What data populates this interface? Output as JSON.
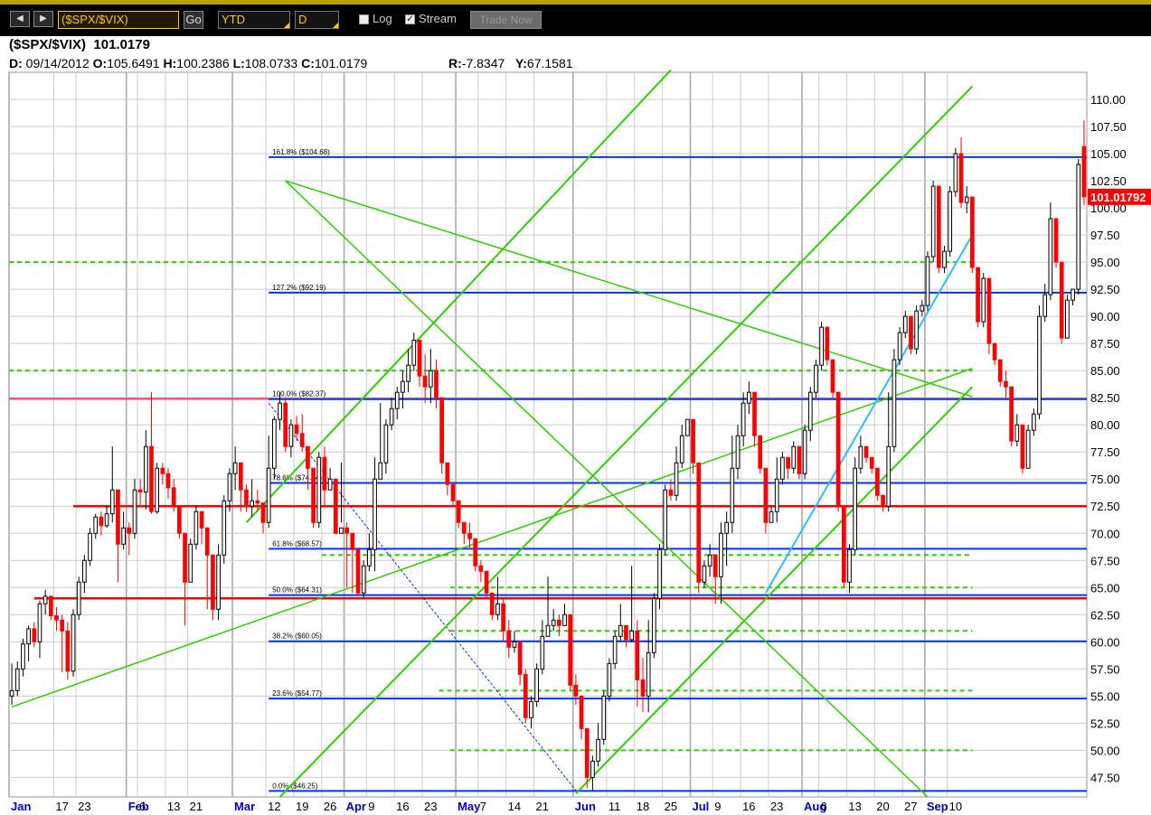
{
  "toolbar": {
    "symbol": "($SPX/$VIX)",
    "go_label": "Go",
    "range": "YTD",
    "period": "D",
    "log_label": "Log",
    "log_checked": false,
    "stream_label": "Stream",
    "stream_checked": true,
    "trade_label": "Trade Now",
    "prev_glyph": "◀",
    "next_glyph": "▶",
    "check_glyph": "✓"
  },
  "header": {
    "symbol": "($SPX/$VIX)",
    "last": "101.0179",
    "d_label": "D:",
    "date": "09/14/2012",
    "o_label": "O:",
    "open": "105.6491",
    "h_label": "H:",
    "high": "100.2386",
    "l_label": "L:",
    "low": "108.0733",
    "c_label": "C:",
    "close": "101.0179",
    "r_label": "R:",
    "r": "-7.8347",
    "y_label": "Y:",
    "y": "67.1581"
  },
  "colors": {
    "up": "#000000",
    "down": "#ff0000",
    "fib": "#0033ff",
    "support": "#ff0000",
    "pink": "#ff3366",
    "trend": "#33cc00",
    "dotted": "#33cc00",
    "cyan": "#33bbff",
    "price_label_bg": "#ff0000",
    "grid": "#cccccc",
    "month_label": "#0000cc"
  },
  "chart_data": {
    "type": "candlestick",
    "title": "($SPX/$VIX) 101.0179",
    "ylim": [
      45.7,
      112.5
    ],
    "y_ticks": [
      "110.00",
      "107.50",
      "105.00",
      "102.50",
      "100.00",
      "97.50",
      "95.00",
      "92.50",
      "90.00",
      "87.50",
      "85.00",
      "82.50",
      "80.00",
      "77.50",
      "75.00",
      "72.50",
      "70.00",
      "67.50",
      "65.00",
      "62.50",
      "60.00",
      "57.50",
      "55.00",
      "52.50",
      "50.00",
      "47.50"
    ],
    "x_labels": [
      {
        "label": "Jan",
        "month": true,
        "i": 0
      },
      {
        "label": "17",
        "i": 8
      },
      {
        "label": "23",
        "i": 12
      },
      {
        "label": "Feb",
        "month": true,
        "i": 21
      },
      {
        "label": "6",
        "i": 23
      },
      {
        "label": "13",
        "i": 28
      },
      {
        "label": "21",
        "i": 32
      },
      {
        "label": "Mar",
        "month": true,
        "i": 40
      },
      {
        "label": "12",
        "i": 46
      },
      {
        "label": "19",
        "i": 51
      },
      {
        "label": "26",
        "i": 56
      },
      {
        "label": "Apr",
        "month": true,
        "i": 60
      },
      {
        "label": "9",
        "i": 64
      },
      {
        "label": "16",
        "i": 69
      },
      {
        "label": "23",
        "i": 74
      },
      {
        "label": "May",
        "month": true,
        "i": 80
      },
      {
        "label": "7",
        "i": 84
      },
      {
        "label": "14",
        "i": 89
      },
      {
        "label": "21",
        "i": 94
      },
      {
        "label": "Jun",
        "month": true,
        "i": 101
      },
      {
        "label": "11",
        "i": 107
      },
      {
        "label": "18",
        "i": 112
      },
      {
        "label": "25",
        "i": 117
      },
      {
        "label": "Jul",
        "month": true,
        "i": 122
      },
      {
        "label": "9",
        "i": 126
      },
      {
        "label": "16",
        "i": 131
      },
      {
        "label": "23",
        "i": 136
      },
      {
        "label": "Aug",
        "month": true,
        "i": 142
      },
      {
        "label": "6",
        "i": 145
      },
      {
        "label": "13",
        "i": 150
      },
      {
        "label": "20",
        "i": 155
      },
      {
        "label": "27",
        "i": 160
      },
      {
        "label": "Sep",
        "month": true,
        "i": 164
      },
      {
        "label": "10",
        "i": 168
      }
    ],
    "last_price_label": "101.01792",
    "fib_levels": [
      {
        "label": "161.8% ($104.68)",
        "value": 104.68
      },
      {
        "label": "127.2% ($92.19)",
        "value": 92.19
      },
      {
        "label": "100.0% ($82.37)",
        "value": 82.37
      },
      {
        "label": "78.6% ($74.64)",
        "value": 74.64
      },
      {
        "label": "61.8% ($68.57)",
        "value": 68.57
      },
      {
        "label": "50.0% ($64.31)",
        "value": 64.31
      },
      {
        "label": "38.2% ($60.05)",
        "value": 60.05
      },
      {
        "label": "23.6% ($54.77)",
        "value": 54.77
      },
      {
        "label": "0.0% ($46.25)",
        "value": 46.25
      }
    ],
    "support_levels": [
      72.5,
      64.0
    ],
    "pink_level": 82.4,
    "dotted_levels": [
      {
        "value": 95.0,
        "from": 0,
        "to": 172
      },
      {
        "value": 85.0,
        "from": 0,
        "to": 172
      },
      {
        "value": 68.0,
        "from": 56,
        "to": 172
      },
      {
        "value": 65.0,
        "from": 79,
        "to": 172
      },
      {
        "value": 61.0,
        "from": 79,
        "to": 172
      },
      {
        "value": 55.5,
        "from": 77,
        "to": 172
      },
      {
        "value": 50.0,
        "from": 79,
        "to": 172
      }
    ],
    "trendlines": [
      {
        "x1": 0,
        "y1": 54.0,
        "x2": 172,
        "y2": 85.2,
        "w": 1.5
      },
      {
        "x1": 42,
        "y1": 71.0,
        "x2": 118,
        "y2": 112.7,
        "w": 2
      },
      {
        "x1": 48,
        "y1": 45.7,
        "x2": 172,
        "y2": 111.2,
        "w": 2
      },
      {
        "x1": 49,
        "y1": 102.5,
        "x2": 164,
        "y2": 45.7,
        "w": 1.5
      },
      {
        "x1": 49,
        "y1": 102.5,
        "x2": 172,
        "y2": 82.6,
        "w": 1.5
      },
      {
        "x1": 101,
        "y1": 46.0,
        "x2": 172,
        "y2": 83.5,
        "w": 2
      }
    ],
    "cyan_lines": [
      {
        "x1": 135,
        "y1": 64.5,
        "x2": 172,
        "y2": 97.5
      }
    ],
    "dashed_lines": [
      {
        "x1": 46,
        "y1": 82.0,
        "x2": 101,
        "y2": 46.3
      }
    ],
    "candles": [
      [
        55,
        55.5,
        58,
        54.2
      ],
      [
        55.5,
        57.5,
        58.2,
        55
      ],
      [
        57.5,
        59.8,
        60.3,
        56.8
      ],
      [
        59.8,
        61.2,
        61.5,
        58.2
      ],
      [
        61.2,
        60,
        61.8,
        59.5
      ],
      [
        60,
        63.5,
        63.8,
        58.5
      ],
      [
        63.5,
        64.2,
        64.8,
        62.5
      ],
      [
        64.2,
        62.4,
        63.8,
        62
      ],
      [
        62.4,
        62,
        63.2,
        61
      ],
      [
        62,
        61,
        62.5,
        57.2
      ],
      [
        61,
        57.3,
        61.8,
        56.5
      ],
      [
        57.3,
        62.5,
        63,
        56.8
      ],
      [
        62.5,
        65.5,
        66,
        62
      ],
      [
        65.5,
        67.5,
        68,
        64.5
      ],
      [
        67.5,
        70,
        70.5,
        67
      ],
      [
        70,
        71.5,
        71.8,
        69.5
      ],
      [
        71.5,
        70.7,
        72,
        69.8
      ],
      [
        70.7,
        71.8,
        72.5,
        70.5
      ],
      [
        71.8,
        74,
        78,
        71
      ],
      [
        74,
        69,
        70,
        65.5
      ],
      [
        69,
        70.5,
        72,
        68.5
      ],
      [
        70.5,
        70,
        71,
        68
      ],
      [
        70,
        74,
        75,
        69.5
      ],
      [
        74,
        73.8,
        75,
        72.5
      ],
      [
        73.8,
        78,
        79.5,
        72.2
      ],
      [
        78,
        72,
        83,
        71.8
      ],
      [
        72,
        76,
        76.5,
        71.8
      ],
      [
        76,
        75.5,
        76.5,
        74.5
      ],
      [
        75.5,
        74.2,
        76,
        73.2
      ],
      [
        74.2,
        72.5,
        75,
        72
      ],
      [
        72.5,
        70,
        72.5,
        69.5
      ],
      [
        70,
        65.5,
        67.5,
        61.5
      ],
      [
        65.5,
        69,
        69.5,
        67.2
      ],
      [
        69,
        72,
        72.5,
        68.5
      ],
      [
        72,
        70.5,
        72,
        69
      ],
      [
        70.5,
        68,
        69,
        63
      ],
      [
        68,
        63,
        64.5,
        62
      ],
      [
        63,
        68,
        69,
        62
      ],
      [
        68,
        73,
        73.5,
        67.2
      ],
      [
        73,
        75.5,
        76,
        72
      ],
      [
        75.5,
        76.5,
        78,
        74
      ],
      [
        76.5,
        74,
        75,
        72
      ],
      [
        74,
        72.5,
        74.5,
        72
      ],
      [
        72.5,
        73,
        75,
        71.5
      ],
      [
        73,
        72.8,
        74,
        72
      ],
      [
        72.8,
        71,
        72,
        70
      ],
      [
        71,
        76,
        79,
        70.5
      ],
      [
        76,
        80.5,
        80.8,
        75
      ],
      [
        80.5,
        82,
        83,
        79.5
      ],
      [
        82,
        78,
        82.5,
        77.5
      ],
      [
        78,
        80,
        80.5,
        77
      ],
      [
        80,
        79.2,
        80.8,
        78.5
      ],
      [
        79.2,
        78,
        81,
        77.5
      ],
      [
        78,
        76,
        78,
        74
      ],
      [
        76,
        71,
        74,
        70.5
      ],
      [
        71,
        77,
        77.5,
        70.5
      ],
      [
        77,
        74,
        78,
        72.5
      ],
      [
        74,
        75,
        76,
        74
      ],
      [
        75,
        70,
        72.5,
        70.5
      ],
      [
        70,
        70.5,
        76.5,
        71
      ],
      [
        70.5,
        70,
        71,
        65
      ],
      [
        70,
        68.5,
        69.5,
        64.5
      ],
      [
        68.5,
        64.5,
        66.5,
        64.2
      ],
      [
        64.5,
        67,
        67.5,
        64
      ],
      [
        67,
        68.5,
        70,
        66.5
      ],
      [
        68.5,
        75,
        77,
        66.5
      ],
      [
        75,
        76.5,
        82,
        75
      ],
      [
        76.5,
        80,
        80.5,
        75.5
      ],
      [
        80,
        81.5,
        82.5,
        79.5
      ],
      [
        81.5,
        83,
        83.5,
        80.5
      ],
      [
        83,
        84,
        85,
        81.5
      ],
      [
        84,
        85.5,
        87,
        83
      ],
      [
        85.5,
        87.8,
        88.5,
        85
      ],
      [
        87.8,
        84.5,
        86,
        83.5
      ],
      [
        84.5,
        83.5,
        86.5,
        82
      ],
      [
        83.5,
        85,
        87,
        82
      ],
      [
        85,
        82.5,
        86,
        81.5
      ],
      [
        82.5,
        76.5,
        82.5,
        75.5
      ],
      [
        76.5,
        74.5,
        75,
        73.5
      ],
      [
        74.5,
        73,
        74,
        72.5
      ],
      [
        73,
        71,
        72,
        70.5
      ],
      [
        71,
        70,
        70.5,
        69
      ],
      [
        70,
        69.5,
        71,
        68.5
      ],
      [
        69.5,
        67,
        69,
        66.5
      ],
      [
        67,
        66.5,
        67.5,
        65.5
      ],
      [
        66.5,
        64.5,
        66,
        64
      ],
      [
        64.5,
        62.5,
        64,
        62
      ],
      [
        62.5,
        63.5,
        66,
        62
      ],
      [
        63.5,
        61,
        64,
        60
      ],
      [
        61,
        59.5,
        62,
        58.5
      ],
      [
        59.5,
        60,
        61,
        59
      ],
      [
        60,
        57,
        59,
        56
      ],
      [
        57,
        53,
        57.5,
        52.5
      ],
      [
        53,
        54.5,
        55,
        52
      ],
      [
        54.5,
        57.5,
        58,
        54
      ],
      [
        57.5,
        60.5,
        62,
        57
      ],
      [
        60.5,
        61.5,
        66,
        60.5
      ],
      [
        61.5,
        62,
        63,
        61
      ],
      [
        62,
        61.5,
        62.5,
        60.5
      ],
      [
        61.5,
        62.5,
        63.5,
        61.5
      ],
      [
        62.5,
        56,
        58,
        55.5
      ],
      [
        56,
        55,
        57,
        54.2
      ],
      [
        55,
        52,
        53,
        51
      ],
      [
        52,
        47.5,
        51,
        46.5
      ],
      [
        47.5,
        49,
        49.5,
        46.3
      ],
      [
        49,
        51,
        52.5,
        48.5
      ],
      [
        51,
        55,
        55.5,
        50.5
      ],
      [
        55,
        58,
        58.5,
        54.5
      ],
      [
        58,
        60.5,
        61,
        57.5
      ],
      [
        60.5,
        61.5,
        63.5,
        60
      ],
      [
        61.5,
        60.2,
        61.5,
        59.5
      ],
      [
        60.2,
        61,
        67,
        60
      ],
      [
        61,
        56.5,
        62,
        54
      ],
      [
        56.5,
        55,
        58.5,
        53.5
      ],
      [
        55,
        59,
        62,
        53.5
      ],
      [
        59,
        64,
        64.5,
        58.5
      ],
      [
        64,
        68.5,
        69,
        63
      ],
      [
        68.5,
        74,
        74.5,
        68
      ],
      [
        74,
        73.5,
        75,
        73
      ],
      [
        73.5,
        76.5,
        78,
        73
      ],
      [
        76.5,
        79,
        80,
        76
      ],
      [
        79,
        80.5,
        80.5,
        79
      ],
      [
        80.5,
        76.5,
        80.5,
        75.5
      ],
      [
        76.5,
        65.5,
        67,
        64.5
      ],
      [
        65.5,
        67,
        67.5,
        65
      ],
      [
        67,
        68,
        69,
        66
      ],
      [
        68,
        66,
        66.5,
        63.5
      ],
      [
        66,
        70,
        71,
        63.5
      ],
      [
        70,
        71,
        72,
        67
      ],
      [
        71,
        76,
        79,
        70
      ],
      [
        76,
        79,
        80,
        75
      ],
      [
        79,
        82,
        83,
        78
      ],
      [
        82,
        83,
        84,
        81
      ],
      [
        83,
        79,
        80,
        78
      ],
      [
        79,
        76,
        76.5,
        75.5
      ],
      [
        76,
        71,
        73,
        70
      ],
      [
        71,
        72,
        72.5,
        71
      ],
      [
        72,
        75,
        77,
        71
      ],
      [
        75,
        77,
        77.5,
        74.5
      ],
      [
        77,
        76,
        76.5,
        75
      ],
      [
        76,
        78,
        78.5,
        75.5
      ],
      [
        78,
        75.5,
        76,
        75
      ],
      [
        75.5,
        79.5,
        80,
        75
      ],
      [
        79.5,
        83,
        83.5,
        78.5
      ],
      [
        83,
        85.5,
        86,
        82.5
      ],
      [
        85.5,
        89,
        89.5,
        85
      ],
      [
        89,
        86,
        86.5,
        85.5
      ],
      [
        86,
        83,
        84,
        82.5
      ],
      [
        83,
        72.5,
        74,
        72
      ],
      [
        72.5,
        65.5,
        67,
        65
      ],
      [
        65.5,
        68.5,
        69,
        64.5
      ],
      [
        68.5,
        76,
        77,
        68
      ],
      [
        76,
        78,
        79,
        75.5
      ],
      [
        78,
        77,
        77.5,
        76.5
      ],
      [
        77,
        76,
        76.5,
        75.5
      ],
      [
        76,
        73.5,
        74,
        73
      ],
      [
        73.5,
        72.5,
        73,
        72
      ],
      [
        72.5,
        78,
        83,
        72
      ],
      [
        78,
        86,
        87,
        77.5
      ],
      [
        86,
        88.5,
        89,
        85.5
      ],
      [
        88.5,
        90,
        90.5,
        88
      ],
      [
        90,
        87,
        89,
        86.5
      ],
      [
        87,
        90.5,
        91,
        86.5
      ],
      [
        90.5,
        91,
        91.5,
        90
      ],
      [
        91,
        95.5,
        96,
        90.5
      ],
      [
        95.5,
        102,
        102.5,
        95
      ],
      [
        102,
        94.5,
        98,
        94
      ],
      [
        94.5,
        96,
        96.5,
        94
      ],
      [
        96,
        101.5,
        102,
        95.5
      ],
      [
        101.5,
        105,
        105.5,
        101
      ],
      [
        105,
        100.5,
        106.5,
        100
      ],
      [
        100.5,
        101,
        102,
        99.5
      ],
      [
        101,
        94.5,
        98,
        94
      ],
      [
        94.5,
        89.5,
        91,
        89
      ],
      [
        89.5,
        93.5,
        94,
        89
      ],
      [
        93.5,
        87.5,
        91,
        86.5
      ],
      [
        87.5,
        86,
        87.5,
        85.5
      ],
      [
        86,
        84,
        84.5,
        83.5
      ],
      [
        84,
        83.5,
        85,
        82.5
      ],
      [
        83.5,
        78.5,
        80,
        78
      ],
      [
        78.5,
        80,
        81,
        78
      ],
      [
        80,
        76,
        76.5,
        75.5
      ],
      [
        76,
        79.5,
        80,
        79
      ],
      [
        79.5,
        81,
        81.5,
        79
      ],
      [
        81,
        90,
        91,
        80.5
      ],
      [
        90,
        92,
        93,
        89.5
      ],
      [
        92,
        99,
        100.5,
        91.5
      ],
      [
        99,
        95,
        96,
        94.5
      ],
      [
        95,
        88,
        91,
        87.5
      ],
      [
        88,
        91.5,
        92,
        88
      ],
      [
        91.5,
        92.5,
        92.5,
        91
      ],
      [
        92.5,
        104,
        104.5,
        92
      ],
      [
        105.65,
        101.02,
        108.07,
        100.24
      ]
    ]
  }
}
